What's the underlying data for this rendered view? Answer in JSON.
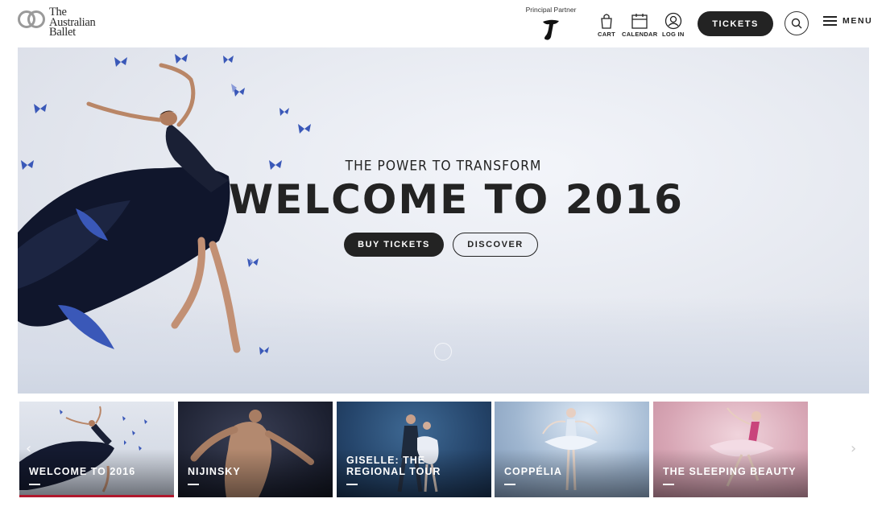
{
  "header": {
    "logo": {
      "line1": "The",
      "line2": "Australian",
      "line3": "Ballet"
    },
    "partner_label": "Principal Partner",
    "cart_label": "CART",
    "calendar_label": "CALENDAR",
    "login_label": "LOG IN",
    "tickets_label": "TICKETS",
    "menu_label": "MENU"
  },
  "hero": {
    "subtitle": "THE POWER TO TRANSFORM",
    "title": "WELCOME TO 2016",
    "buy_label": "BUY TICKETS",
    "discover_label": "DISCOVER"
  },
  "carousel": {
    "slides": [
      {
        "title": "WELCOME TO 2016",
        "active": true
      },
      {
        "title": "NIJINSKY",
        "active": false
      },
      {
        "title": "GISELLE: THE REGIONAL TOUR",
        "active": false
      },
      {
        "title": "COPPÉLIA",
        "active": false
      },
      {
        "title": "THE SLEEPING BEAUTY",
        "active": false
      }
    ],
    "prev_icon": "chevron-left-icon",
    "next_icon": "chevron-right-icon"
  },
  "colors": {
    "dark": "#232323",
    "active_bar": "#b0182d",
    "butterfly": "#3a58b8"
  }
}
